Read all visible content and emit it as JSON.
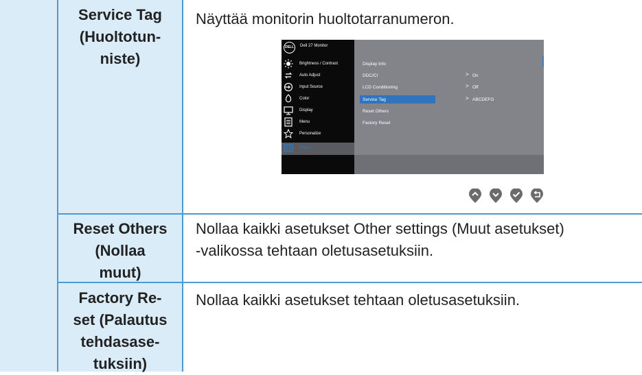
{
  "rows": [
    {
      "name_lines": [
        "Service Tag",
        "(Huoltotun-",
        "niste)"
      ],
      "desc_lines": [
        "Näyttää monitorin huoltotarranumeron."
      ]
    },
    {
      "name_lines": [
        "Reset Others",
        "(Nollaa",
        "muut)"
      ],
      "desc_lines": [
        "Nollaa kaikki asetukset Other settings (Muut asetukset)",
        "-valikossa tehtaan oletusasetuksiin."
      ]
    },
    {
      "name_lines": [
        "Factory Re-",
        "set (Palautus",
        "tehdasase-",
        "tuksiin)"
      ],
      "desc_lines": [
        "Nollaa kaikki asetukset tehtaan oletusasetuksiin."
      ]
    }
  ],
  "osd": {
    "logo": "DELL",
    "title": "Dell 27 Monitor",
    "menu": [
      {
        "label": "Brightness / Contrast",
        "icon": "brightness-icon"
      },
      {
        "label": "Auto Adjust",
        "icon": "auto-adjust-icon"
      },
      {
        "label": "Input Source",
        "icon": "input-source-icon"
      },
      {
        "label": "Color",
        "icon": "color-icon"
      },
      {
        "label": "Display",
        "icon": "display-icon"
      },
      {
        "label": "Menu",
        "icon": "menu-icon"
      },
      {
        "label": "Personalize",
        "icon": "star-icon"
      },
      {
        "label": "Others",
        "icon": "others-icon"
      }
    ],
    "submenu": [
      "Display Info",
      "DDC/CI",
      "LCD Conditioning",
      "Service Tag",
      "Reset Others",
      "Factory Reset"
    ],
    "values": {
      "ddc_ci": "On",
      "lcd_conditioning": "Off",
      "service_tag": "ABCDEFG"
    },
    "highlight_color": "#2f74bd"
  },
  "nav_buttons": [
    "up-icon",
    "down-icon",
    "check-icon",
    "back-icon"
  ],
  "colors": {
    "rule": "#4a9bd1",
    "name_bg": "#d9ecf8",
    "text": "#222222"
  }
}
